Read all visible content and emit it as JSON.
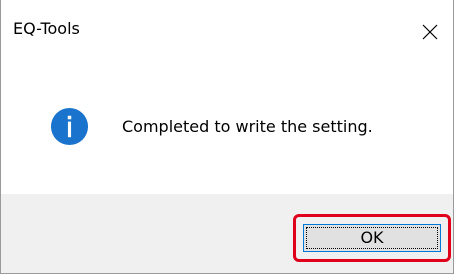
{
  "window": {
    "title": "EQ-Tools",
    "close_icon": "close-icon"
  },
  "content": {
    "icon": "info-icon",
    "message": "Completed to write the setting."
  },
  "footer": {
    "ok_label": "OK"
  },
  "colors": {
    "info_icon": "#1a73cc",
    "highlight": "#e0001b",
    "button_border": "#0078d7",
    "footer_bg": "#f0f0f0"
  }
}
